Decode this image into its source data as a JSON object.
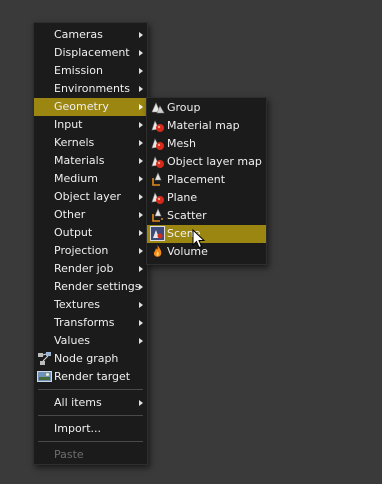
{
  "main_menu": {
    "items": [
      {
        "label": "Cameras",
        "submenu": true
      },
      {
        "label": "Displacement",
        "submenu": true
      },
      {
        "label": "Emission",
        "submenu": true
      },
      {
        "label": "Environments",
        "submenu": true
      },
      {
        "label": "Geometry",
        "submenu": true,
        "highlighted": true
      },
      {
        "label": "Input",
        "submenu": true
      },
      {
        "label": "Kernels",
        "submenu": true
      },
      {
        "label": "Materials",
        "submenu": true
      },
      {
        "label": "Medium",
        "submenu": true
      },
      {
        "label": "Object layer",
        "submenu": true
      },
      {
        "label": "Other",
        "submenu": true
      },
      {
        "label": "Output",
        "submenu": true
      },
      {
        "label": "Projection",
        "submenu": true
      },
      {
        "label": "Render job",
        "submenu": true
      },
      {
        "label": "Render settings",
        "submenu": true
      },
      {
        "label": "Textures",
        "submenu": true
      },
      {
        "label": "Transforms",
        "submenu": true
      },
      {
        "label": "Values",
        "submenu": true
      },
      {
        "label": "Node graph",
        "icon": "node-graph-icon"
      },
      {
        "label": "Render target",
        "icon": "render-target-icon"
      },
      {
        "label": "All items",
        "submenu": true
      },
      {
        "label": "Import..."
      },
      {
        "label": "Paste",
        "disabled": true
      }
    ]
  },
  "geometry_submenu": {
    "items": [
      {
        "label": "Group",
        "icon": "group-icon"
      },
      {
        "label": "Material map",
        "icon": "material-map-icon"
      },
      {
        "label": "Mesh",
        "icon": "mesh-icon"
      },
      {
        "label": "Object layer map",
        "icon": "object-layer-map-icon"
      },
      {
        "label": "Placement",
        "icon": "placement-icon"
      },
      {
        "label": "Plane",
        "icon": "plane-icon"
      },
      {
        "label": "Scatter",
        "icon": "scatter-icon"
      },
      {
        "label": "Scene",
        "icon": "scene-icon",
        "highlighted": true
      },
      {
        "label": "Volume",
        "icon": "volume-icon"
      }
    ]
  },
  "colors": {
    "menu_background": "#1b1b1b",
    "highlight": "#9b8611",
    "desktop_background": "#3a3a3a",
    "disabled_text": "#6c6c6c"
  }
}
